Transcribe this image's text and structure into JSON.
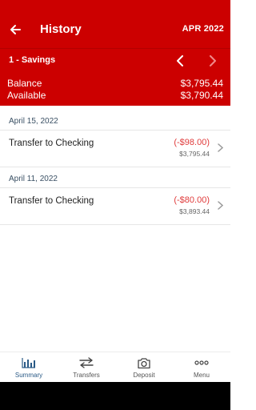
{
  "header": {
    "title": "History",
    "month": "APR 2022"
  },
  "account": {
    "name": "1 - Savings",
    "balance_label": "Balance",
    "balance_value": "$3,795.44",
    "available_label": "Available",
    "available_value": "$3,790.44"
  },
  "groups": [
    {
      "date": "April 15, 2022",
      "transactions": [
        {
          "description": "Transfer to Checking",
          "amount": "(-$98.00)",
          "running_balance": "$3,795.44"
        }
      ]
    },
    {
      "date": "April 11, 2022",
      "transactions": [
        {
          "description": "Transfer to Checking",
          "amount": "(-$80.00)",
          "running_balance": "$3,893.44"
        }
      ]
    }
  ],
  "bottom_nav": [
    {
      "label": "Summary",
      "icon": "bar-chart-icon",
      "active": true
    },
    {
      "label": "Transfers",
      "icon": "transfer-arrows-icon",
      "active": false
    },
    {
      "label": "Deposit",
      "icon": "camera-icon",
      "active": false
    },
    {
      "label": "Menu",
      "icon": "more-dots-icon",
      "active": false
    }
  ],
  "colors": {
    "brand_red": "#cc0000",
    "debit_red": "#e03b3b",
    "active_nav": "#2a5a86"
  }
}
